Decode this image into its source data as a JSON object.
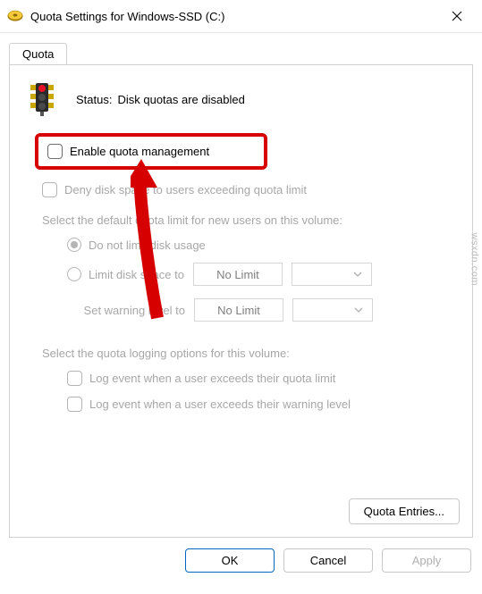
{
  "titlebar": {
    "title": "Quota Settings for Windows-SSD (C:)"
  },
  "tab": {
    "label": "Quota"
  },
  "status": {
    "label": "Status:",
    "value": "Disk quotas are disabled"
  },
  "options": {
    "enable_quota": "Enable quota management",
    "deny_space": "Deny disk space to users exceeding quota limit",
    "default_desc": "Select the default quota limit for new users on this volume:",
    "radio_no_limit": "Do not limit disk usage",
    "radio_limit_to": "Limit disk space to",
    "no_limit_value": "No Limit",
    "warn_label": "Set warning level to",
    "warn_value": "No Limit",
    "logging_desc": "Select the quota logging options for this volume:",
    "log_exceed_limit": "Log event when a user exceeds their quota limit",
    "log_exceed_warning": "Log event when a user exceeds their warning level"
  },
  "buttons": {
    "quota_entries": "Quota Entries...",
    "ok": "OK",
    "cancel": "Cancel",
    "apply": "Apply"
  },
  "watermark": "wsxdn.com"
}
